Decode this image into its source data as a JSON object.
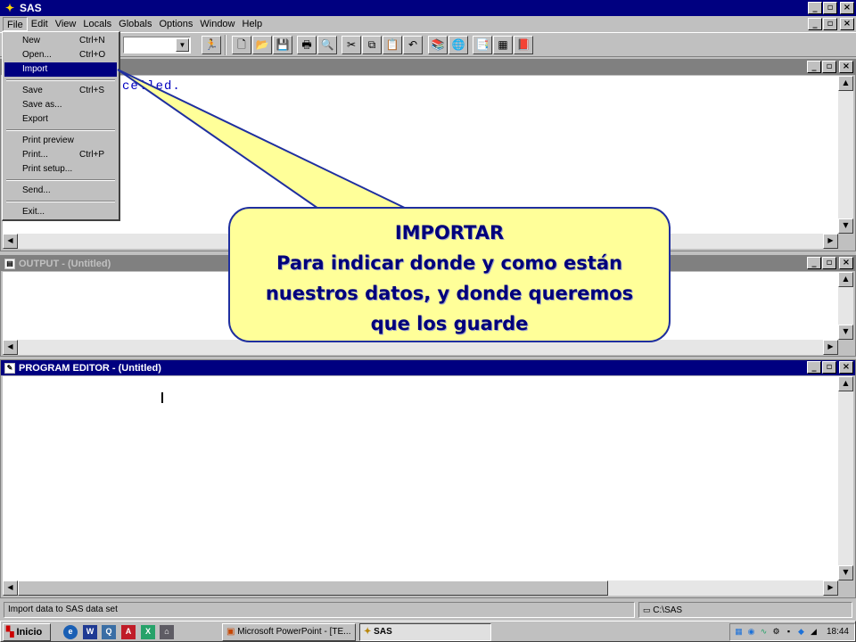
{
  "app": {
    "title": "SAS"
  },
  "menubar": [
    {
      "label": "File"
    },
    {
      "label": "Edit"
    },
    {
      "label": "View"
    },
    {
      "label": "Locals"
    },
    {
      "label": "Globals"
    },
    {
      "label": "Options"
    },
    {
      "label": "Window"
    },
    {
      "label": "Help"
    }
  ],
  "caption_buttons": {
    "minimize": "_",
    "restore": "▫",
    "close": "×"
  },
  "file_menu": {
    "items": [
      {
        "label": "New",
        "accel": "Ctrl+N"
      },
      {
        "label": "Open...",
        "accel": "Ctrl+O"
      },
      {
        "label": "Import",
        "accel": ""
      },
      {
        "label": "Save",
        "accel": "Ctrl+S"
      },
      {
        "label": "Save as...",
        "accel": ""
      },
      {
        "label": "Export",
        "accel": ""
      },
      {
        "label": "Print preview",
        "accel": ""
      },
      {
        "label": "Print...",
        "accel": "Ctrl+P"
      },
      {
        "label": "Print setup...",
        "accel": ""
      },
      {
        "label": "Send...",
        "accel": ""
      },
      {
        "label": "Exit...",
        "accel": ""
      }
    ]
  },
  "log": {
    "text": "celled."
  },
  "output_window": {
    "title": "OUTPUT - (Untitled)"
  },
  "editor_window": {
    "title": "PROGRAM EDITOR - (Untitled)"
  },
  "callout": {
    "heading": "IMPORTAR",
    "line1": "Para indicar donde y como están",
    "line2": "nuestros datos, y donde queremos",
    "line3": "que los guarde",
    "fill": "#ffff99",
    "border": "#1f2f9f",
    "text_color": "#00007a"
  },
  "status": {
    "message": "Import data to SAS data set",
    "path": "C:\\SAS"
  },
  "taskbar": {
    "start_label": "Inicio",
    "tasks": [
      {
        "label": "Microsoft PowerPoint - [TE..."
      },
      {
        "label": "SAS"
      }
    ],
    "clock": "18:44"
  },
  "colors": {
    "title_active": "#000080",
    "title_inactive": "#808080",
    "face": "#c0c0c0"
  }
}
